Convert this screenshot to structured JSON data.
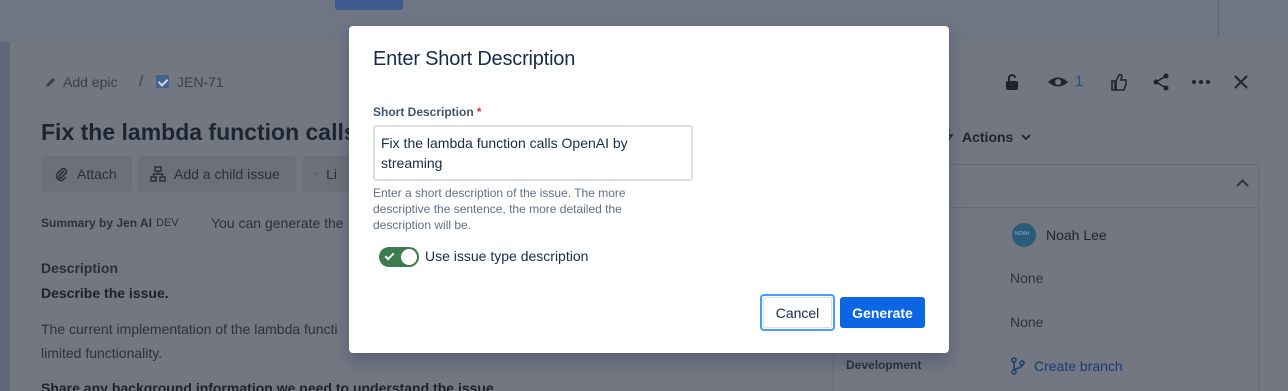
{
  "issue": {
    "add_epic": "Add epic",
    "separator": "/",
    "key": "JEN-71",
    "title": "Fix the lambda function calls O",
    "watch_count": "1",
    "toolbar": {
      "attach": "Attach",
      "add_child": "Add a child issue",
      "link": "Li"
    },
    "actions_label": "Actions",
    "summary_label": "Summary by Jen AI",
    "summary_badge": "DEV",
    "summary_text": "You can generate the",
    "description_heading": "Description",
    "describe_heading": "Describe the issue.",
    "desc_line1": "The current implementation of the lambda functi",
    "desc_line2": "limited functionality.",
    "background_heading": "Share any background information we need to understand the issue."
  },
  "details": {
    "assignee": "Noah Lee",
    "field2": "None",
    "field3": "None",
    "development_label": "Development",
    "create_branch": "Create branch"
  },
  "modal": {
    "title": "Enter Short Description",
    "field_label": "Short Description",
    "required_mark": "*",
    "field_value": "Fix the lambda function calls OpenAI by streaming",
    "helper_text": "Enter a short description of the issue. The more descriptive the sentence, the more detailed the description will be.",
    "toggle_label": "Use issue type description",
    "toggle_on": true,
    "cancel_label": "Cancel",
    "generate_label": "Generate"
  },
  "colors": {
    "primary": "#0c66e4",
    "toggle_on": "#3c7a4f",
    "required": "#c9372c",
    "focus_ring": "#4c9aff"
  }
}
